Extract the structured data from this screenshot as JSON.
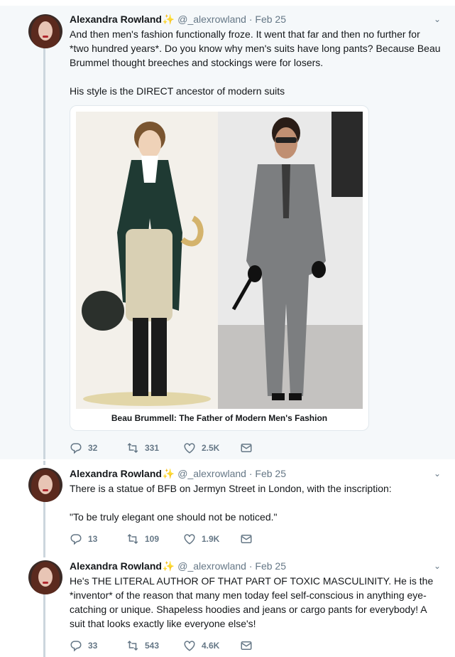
{
  "tweets": [
    {
      "name": "Alexandra Rowland",
      "handle": "@_alexrowland",
      "date": "· Feb 25",
      "text": "And then men's fashion functionally froze. It went that far and then no further for *two hundred years*. Do you know why men's suits have long pants? Because Beau Brummel thought breeches and stockings were for losers.\n\nHis style is the DIRECT ancestor of modern suits",
      "card_caption": "Beau Brummell: The Father of Modern Men's Fashion",
      "replies": "32",
      "retweets": "331",
      "likes": "2.5K"
    },
    {
      "name": "Alexandra Rowland",
      "handle": "@_alexrowland",
      "date": "· Feb 25",
      "text": "There is a statue of BFB on Jermyn Street in London, with the inscription:\n\n\"To be truly elegant one should not be noticed.\"",
      "replies": "13",
      "retweets": "109",
      "likes": "1.9K"
    },
    {
      "name": "Alexandra Rowland",
      "handle": "@_alexrowland",
      "date": "· Feb 25",
      "text": "He's THE LITERAL AUTHOR OF THAT PART OF TOXIC MASCULINITY. He is the *inventor* of the reason that many men today feel self-conscious in anything eye-catching or unique. Shapeless hoodies and jeans or cargo pants for everybody! A suit that looks exactly like everyone else's!",
      "replies": "33",
      "retweets": "543",
      "likes": "4.6K"
    }
  ],
  "icons": {
    "verified_sparkle": "sparkle-icon",
    "menu": "chevron-down-icon",
    "reply": "reply-icon",
    "retweet": "retweet-icon",
    "like": "heart-icon",
    "dm": "envelope-icon"
  },
  "colors": {
    "highlight_bg": "#f5f8fa",
    "thread_line": "#ccd6dd",
    "meta_text": "#657786",
    "sparkle": "#f5b400"
  }
}
